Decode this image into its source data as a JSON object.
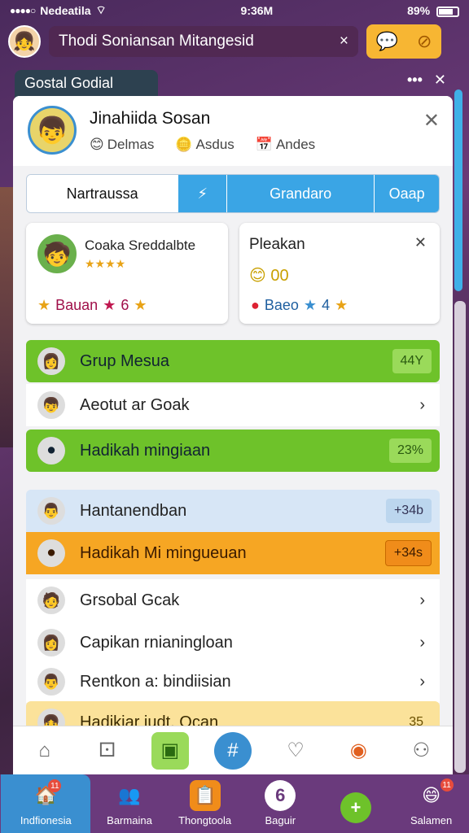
{
  "status_bar": {
    "carrier": "Nedeatila",
    "time": "9:36M",
    "battery": "89%"
  },
  "header": {
    "search_value": "Thodi Soniansan Mitangesid",
    "clear_label": "×"
  },
  "window": {
    "title": "Gostal Godial",
    "more_label": "•••",
    "close_label": "✕"
  },
  "profile": {
    "name": "Jinahiida Sosan",
    "meta": [
      {
        "icon": "smile-icon",
        "glyph": "😊",
        "label": "Delmas"
      },
      {
        "icon": "coin-icon",
        "glyph": "🪙",
        "label": "Asdus"
      },
      {
        "icon": "calendar-icon",
        "glyph": "📅",
        "label": "Andes"
      }
    ],
    "close_label": "✕"
  },
  "tabs": [
    "Nartraussa",
    "⚡",
    "Grandaro",
    "Oaap"
  ],
  "cards": [
    {
      "title": "Coaka Sreddalbte",
      "stars": "★★★★",
      "footer": "Bauan",
      "footer_suffix": "6",
      "close": ""
    },
    {
      "title": "Pleakan",
      "stars": "",
      "footer": "Baeo",
      "footer_suffix": "4",
      "close": "✕",
      "emojis": "😊 00"
    }
  ],
  "list": [
    {
      "label": "Grup Mesua",
      "badge": "44Y",
      "style": "green",
      "icon": "user-icon"
    },
    {
      "label": "Aeotut ar Goak",
      "badge": "",
      "style": "white",
      "icon": "user-icon",
      "chevron": "›"
    },
    {
      "label": "Hadikah mingiaan",
      "badge": "23%",
      "style": "green",
      "icon": "ball-icon"
    },
    {
      "label": "Hantanendban",
      "badge": "+34b",
      "style": "blue",
      "icon": "user-icon"
    },
    {
      "label": "Hadikah Mi mingueuan",
      "badge": "+34s",
      "style": "orange",
      "icon": "ball-icon"
    },
    {
      "label": "Grsobal Gcak",
      "badge": "",
      "style": "white",
      "icon": "user-icon",
      "chevron": "›"
    },
    {
      "label": "Capikan rnianingloan",
      "badge": "",
      "style": "white",
      "icon": "user-icon",
      "chevron": "›"
    },
    {
      "label": "Rentkon a: bindiisian",
      "badge": "",
      "style": "white",
      "icon": "user-icon",
      "chevron": "›"
    },
    {
      "label": "Hadikiar iudt. Ocan",
      "badge": "35",
      "style": "yellow",
      "icon": "user-icon"
    }
  ],
  "bottom_nav": [
    "home-icon",
    "grid-icon",
    "chart-icon",
    "hash-icon",
    "heart-icon",
    "target-icon",
    "person-icon"
  ],
  "tabbar": [
    {
      "label": "Indfionesia",
      "icon": "home-icon",
      "glyph": "🏠",
      "badge": "11"
    },
    {
      "label": "Barmaina",
      "icon": "group-icon",
      "glyph": "👥",
      "badge": ""
    },
    {
      "label": "Thongtoola",
      "icon": "list-icon",
      "glyph": "📋",
      "badge": ""
    },
    {
      "label": "Baguir",
      "icon": "number-icon",
      "glyph": "6",
      "badge": ""
    },
    {
      "label": "",
      "icon": "plus-icon",
      "glyph": "+",
      "badge": ""
    },
    {
      "label": "Salamen",
      "icon": "face-icon",
      "glyph": "😄",
      "badge": "11"
    }
  ],
  "colors": {
    "accent_blue": "#3aa5e5",
    "green": "#6ec22a",
    "orange": "#f6a623",
    "purple_bg": "#6a3a7c"
  }
}
